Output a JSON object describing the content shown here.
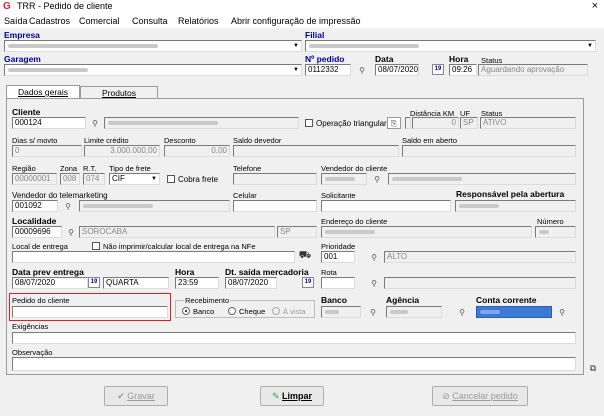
{
  "window": {
    "title": "TRR - Pedido de cliente",
    "close_glyph": "×"
  },
  "menu": [
    "Saída",
    "Cadastros",
    "Comercial",
    "Consulta",
    "Relatórios",
    "Abrir configuração de impressão"
  ],
  "header": {
    "empresa_label": "Empresa",
    "filial_label": "Filial",
    "garagem_label": "Garagem",
    "npedido_label": "Nº pedido",
    "npedido_value": "0112332",
    "data_label": "Data",
    "data_value": "08/07/2020",
    "hora_label": "Hora",
    "hora_value": "09:26",
    "status_label": "Status",
    "status_value": "Aguardando aprovação"
  },
  "tabs": [
    "Dados gerais",
    "Produtos"
  ],
  "form": {
    "cliente_label": "Cliente",
    "cliente_value": "000124",
    "operacao_triangular_label": "Operação triangular",
    "distancia_label": "Distância KM",
    "distancia_value": "0",
    "uf_label": "UF",
    "uf_value": "SP",
    "status_label": "Status",
    "status_value": "ATIVO",
    "dias_label": "Dias s/ movto",
    "dias_value": "0",
    "limite_label": "Limite crédito",
    "limite_value": "3.000.000,00",
    "desconto_label": "Desconto",
    "desconto_value": "0,00",
    "saldo_devedor_label": "Saldo devedor",
    "saldo_aberto_label": "Saldo em aberto",
    "regiao_label": "Região",
    "regiao_value": "00000001",
    "zona_label": "Zona",
    "zona_value": "008",
    "rt_label": "R.T.",
    "rt_value": "074",
    "tipo_frete_label": "Tipo de frete",
    "tipo_frete_value": "CIF",
    "cobra_frete_label": "Cobra frete",
    "telefone_label": "Telefone",
    "vendedor_cliente_label": "Vendedor do cliente",
    "vendedor_tele_label": "Vendedor do telemarketing",
    "vendedor_tele_value": "001092",
    "celular_label": "Celular",
    "solicitante_label": "Solicitante",
    "responsavel_label": "Responsável pela abertura",
    "localidade_label": "Localidade",
    "localidade_value": "00009696",
    "localidade_name": "SOROCABA",
    "localidade_uf": "SP",
    "endereco_label": "Endereço do cliente",
    "numero_label": "Número",
    "local_entrega_label": "Local de entrega",
    "nao_imprimir_label": "Não imprimir/calcular local de entrega na NFe",
    "prioridade_label": "Prioridade",
    "prioridade_value": "001",
    "prioridade_name": "ALTO",
    "data_prev_label": "Data prev entrega",
    "data_prev_value": "08/07/2020",
    "dia_semana": "QUARTA",
    "hora_label": "Hora",
    "hora_value": "23:59",
    "dt_saida_label": "Dt. saída mercadoria",
    "dt_saida_value": "08/07/2020",
    "rota_label": "Rota",
    "pedido_cliente_label": "Pedido do cliente",
    "recebimento_label": "Recebimento",
    "rec_banco": "Banco",
    "rec_cheque": "Cheque",
    "rec_avista": "À vista",
    "banco_label": "Banco",
    "agencia_label": "Agência",
    "conta_label": "Conta corrente",
    "exigencias_label": "Exigências",
    "observacao_label": "Observação"
  },
  "buttons": {
    "gravar": "Gravar",
    "limpar": "Limpar",
    "cancelar": "Cancelar pedido"
  },
  "colors": {
    "label_blue": "#00009c",
    "highlight_red": "#e02020",
    "selection_blue": "#3d7ad6"
  }
}
